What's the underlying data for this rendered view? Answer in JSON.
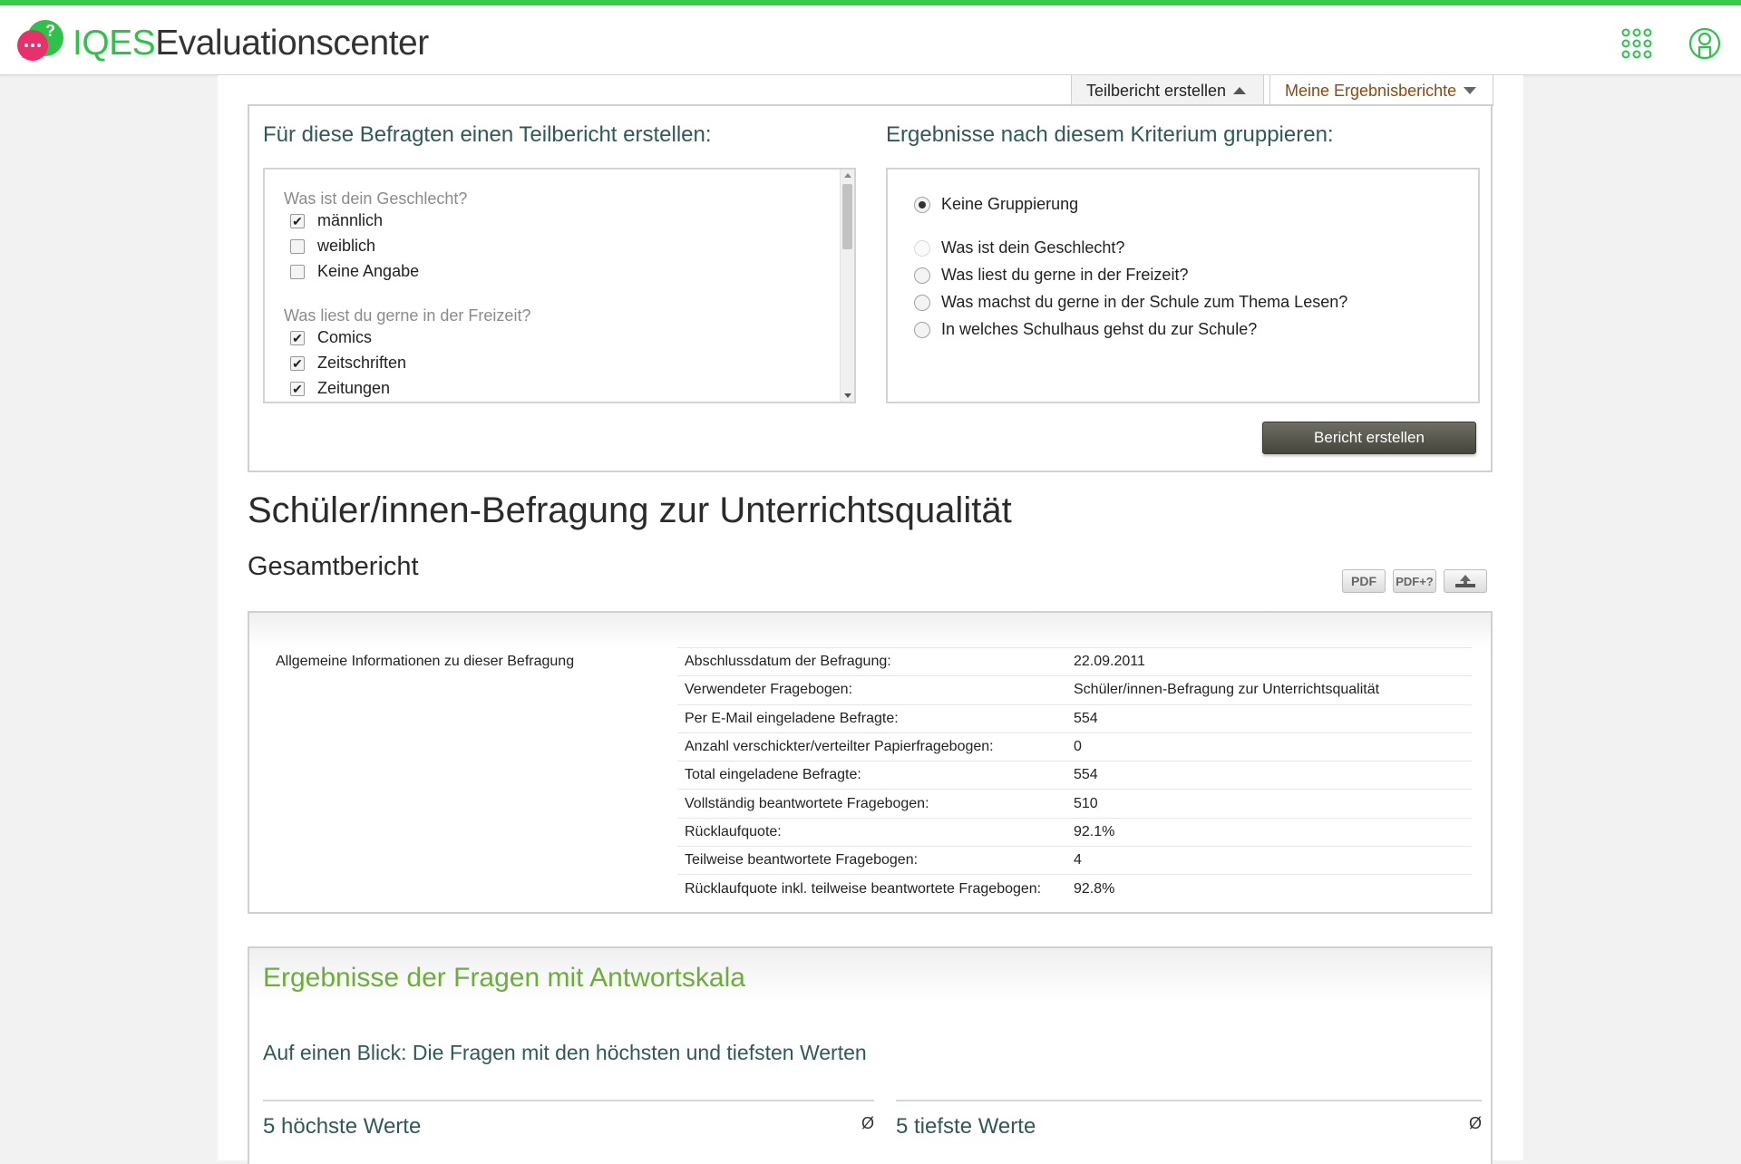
{
  "header": {
    "brand_prefix": "IQES",
    "brand_suffix": "Evaluationscenter",
    "icons": [
      "chat-question-logo-icon",
      "apps-grid-icon",
      "user-profile-icon"
    ],
    "accent_color": "#3ec84a"
  },
  "tabs": [
    {
      "label": "Teilbericht erstellen",
      "active": true
    },
    {
      "label": "Meine Ergebnisberichte",
      "active": false
    }
  ],
  "filter": {
    "left_heading": "Für diese Befragten einen Teilbericht erstellen:",
    "right_heading": "Ergebnisse nach diesem Kriterium gruppieren:",
    "groups": [
      {
        "question": "Was ist dein Geschlecht?",
        "options": [
          {
            "label": "männlich",
            "checked": true
          },
          {
            "label": "weiblich",
            "checked": false
          },
          {
            "label": "Keine Angabe",
            "checked": false
          }
        ]
      },
      {
        "question": "Was liest du gerne in der Freizeit?",
        "options": [
          {
            "label": "Comics",
            "checked": true
          },
          {
            "label": "Zeitschriften",
            "checked": true
          },
          {
            "label": "Zeitungen",
            "checked": true
          }
        ]
      }
    ],
    "grouping": [
      {
        "label": "Keine Gruppierung",
        "selected": true,
        "disabled": false
      },
      {
        "label": "Was ist dein Geschlecht?",
        "selected": false,
        "disabled": true
      },
      {
        "label": "Was liest du gerne in der Freizeit?",
        "selected": false,
        "disabled": false
      },
      {
        "label": "Was machst du gerne in der Schule zum Thema Lesen?",
        "selected": false,
        "disabled": false
      },
      {
        "label": "In welches Schulhaus gehst du zur Schule?",
        "selected": false,
        "disabled": false
      }
    ],
    "submit_label": "Bericht erstellen"
  },
  "report": {
    "title": "Schüler/innen-Befragung zur Unterrichtsqualität",
    "subtitle": "Gesamtbericht",
    "export": {
      "pdf": "PDF",
      "pdf_plus": "PDF+?",
      "download_icon": "download-icon"
    }
  },
  "info": {
    "section_label": "Allgemeine Informationen zu dieser Befragung",
    "rows": [
      {
        "key": "Abschlussdatum der Befragung:",
        "value": "22.09.2011"
      },
      {
        "key": "Verwendeter Fragebogen:",
        "value": "Schüler/innen-Befragung zur Unterrichtsqualität"
      },
      {
        "key": "Per E-Mail eingeladene Befragte:",
        "value": "554"
      },
      {
        "key": "Anzahl verschickter/verteilter Papierfragebogen:",
        "value": "0"
      },
      {
        "key": "Total eingeladene Befragte:",
        "value": "554"
      },
      {
        "key": "Vollständig beantwortete Fragebogen:",
        "value": "510"
      },
      {
        "key": "Rücklaufquote:",
        "value": "92.1%"
      },
      {
        "key": "Teilweise beantwortete Fragebogen:",
        "value": "4"
      },
      {
        "key": "Rücklaufquote inkl. teilweise beantwortete Fragebogen:",
        "value": "92.8%"
      }
    ]
  },
  "results": {
    "title": "Ergebnisse der Fragen mit Antwortskala",
    "subtitle": "Auf einen Blick: Die Fragen mit den höchsten und tiefsten Werten",
    "highest_label": "5 höchste Werte",
    "lowest_label": "5 tiefste Werte",
    "avg_symbol": "Ø"
  }
}
